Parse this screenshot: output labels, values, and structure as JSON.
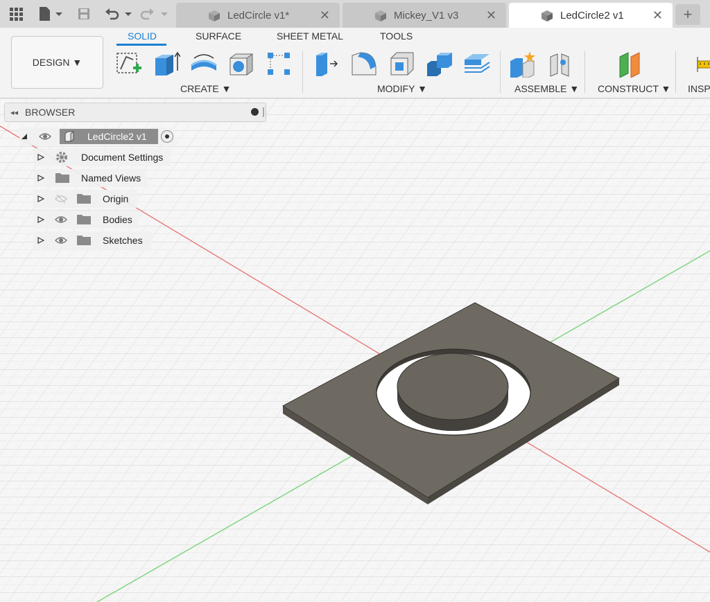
{
  "tabs": [
    {
      "label": "LedCircle v1*",
      "active": false
    },
    {
      "label": "Mickey_V1 v3",
      "active": false
    },
    {
      "label": "LedCircle2 v1",
      "active": true
    }
  ],
  "new_tab_symbol": "+",
  "close_symbol": "✕",
  "workspace": {
    "label": "DESIGN ▼"
  },
  "toolbar_tabs": {
    "solid": "SOLID",
    "surface": "SURFACE",
    "sheet_metal": "SHEET METAL",
    "tools": "TOOLS"
  },
  "groups": {
    "create": "CREATE ▼",
    "modify": "MODIFY ▼",
    "assemble": "ASSEMBLE ▼",
    "construct": "CONSTRUCT ▼",
    "inspect": "INSPE"
  },
  "browser": {
    "title": "BROWSER",
    "root": "LedCircle2 v1",
    "items": [
      {
        "label": "Document Settings",
        "icon": "gear-icon",
        "visible": null
      },
      {
        "label": "Named Views",
        "icon": "folder-icon",
        "visible": null
      },
      {
        "label": "Origin",
        "icon": "folder-icon",
        "visible": false
      },
      {
        "label": "Bodies",
        "icon": "folder-icon",
        "visible": true
      },
      {
        "label": "Sketches",
        "icon": "folder-icon",
        "visible": true
      }
    ]
  },
  "colors": {
    "accent": "#1b7fd0",
    "plate": "#6e6a62",
    "x_axis": "#e87878",
    "y_axis": "#7ad37a"
  }
}
